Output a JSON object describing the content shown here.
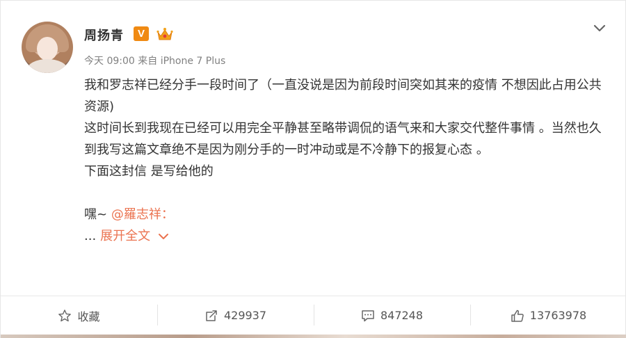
{
  "user": {
    "name": "周扬青",
    "verified_badge": "V",
    "avatar_icon": "user-avatar",
    "crown_icon": "crown-icon",
    "badge_color": "#f08a13"
  },
  "meta": {
    "time": "今天 09:00",
    "source": "来自 iPhone 7 Plus"
  },
  "post": {
    "lines": [
      "我和罗志祥已经分手一段时间了（一直没说是因为前段时间突如其来的疫情 不想因此占用公共资源)",
      "这时间长到我现在已经可以用完全平静甚至略带调侃的语气来和大家交代整件事情 。当然也久到我写这篇文章绝不是因为刚分手的一时冲动或是不冷静下的报复心态 。",
      "下面这封信 是写给他的"
    ],
    "greeting": "嘿~",
    "mention": "@羅志祥：",
    "ellipsis": "...",
    "expand_label": "展开全文"
  },
  "actions": {
    "favorite_label": "收藏",
    "repost_count": "429937",
    "comment_count": "847248",
    "like_count": "13763978"
  },
  "colors": {
    "accent": "#eb7350",
    "text": "#333333",
    "meta": "#808080"
  }
}
